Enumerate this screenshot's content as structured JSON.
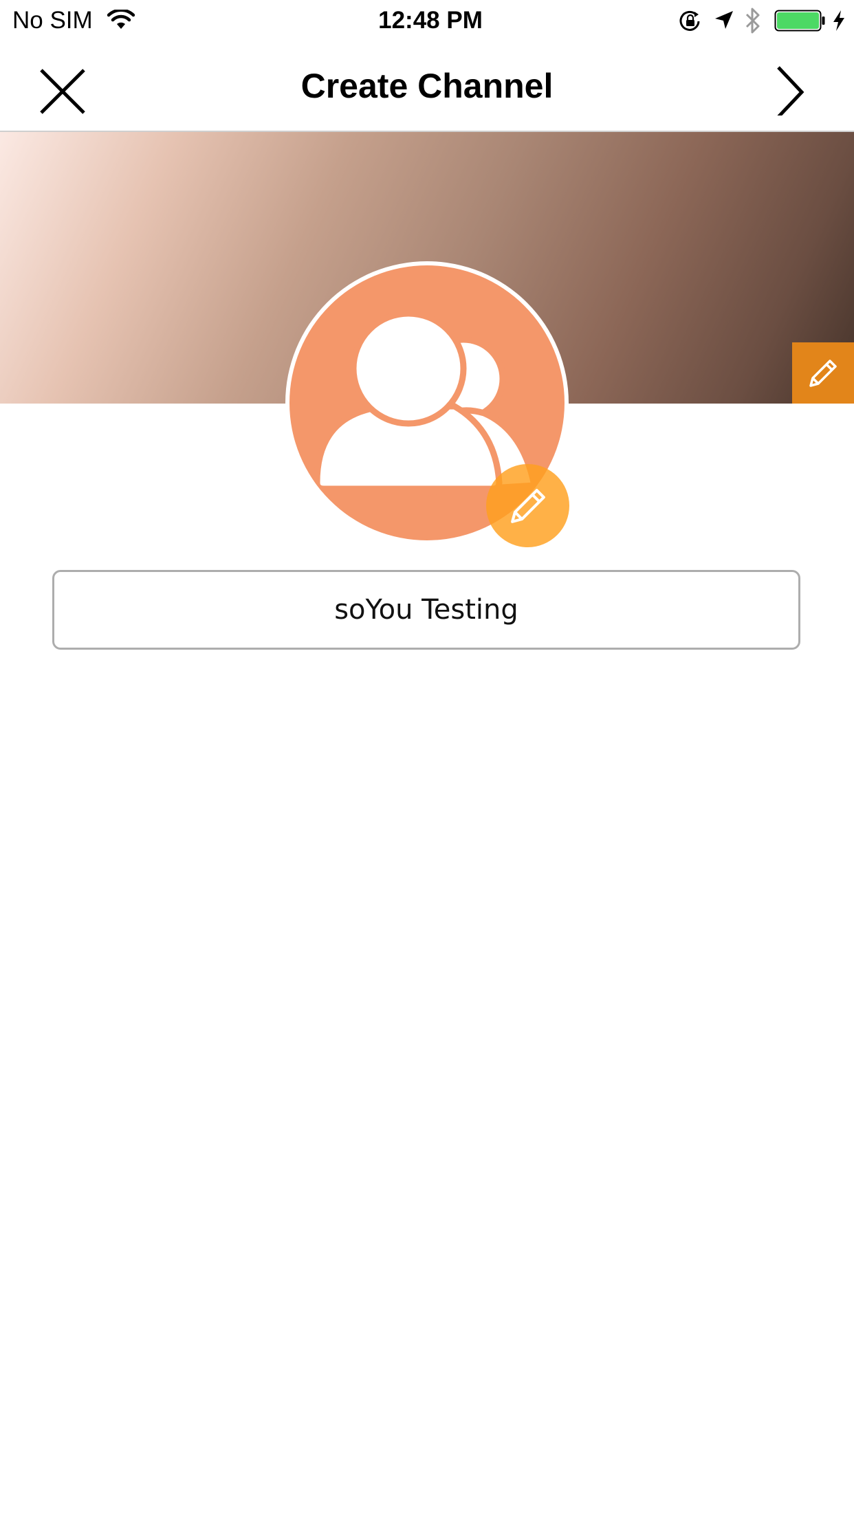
{
  "status_bar": {
    "carrier": "No SIM",
    "time": "12:48 PM",
    "icons": [
      "wifi-icon",
      "rotation-lock-icon",
      "location-arrow-icon",
      "bluetooth-icon",
      "battery-icon",
      "charging-bolt-icon"
    ],
    "battery_color": "#4cd964"
  },
  "nav": {
    "title": "Create Channel",
    "close_icon": "close-icon",
    "next_icon": "chevron-right-icon"
  },
  "cover": {
    "edit_icon": "pencil-icon",
    "edit_button_color": "#e2851a"
  },
  "avatar": {
    "icon": "group-users-icon",
    "background_color": "#f4976a",
    "edit_icon": "pencil-icon",
    "edit_button_color": "#ffa01e"
  },
  "channel_name": {
    "value": "soYou Testing",
    "placeholder": ""
  }
}
